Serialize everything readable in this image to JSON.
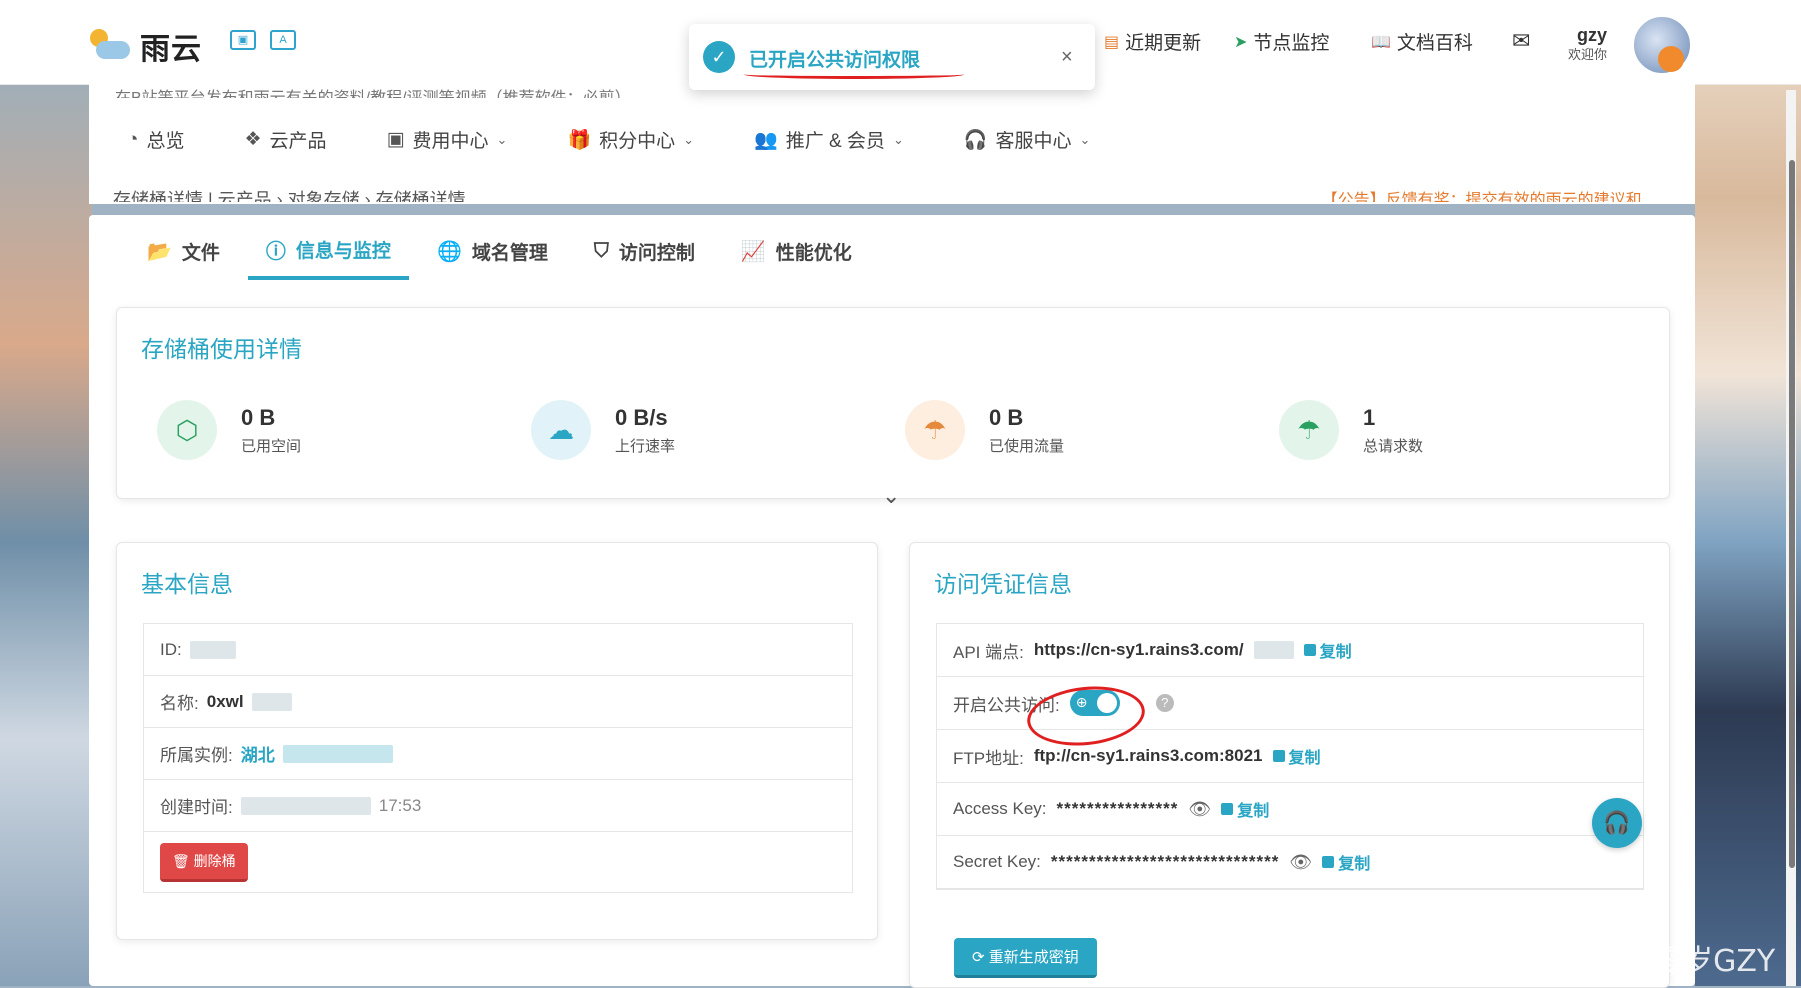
{
  "header": {
    "logo_text": "雨云",
    "links": [
      {
        "icon": "news-icon",
        "label": "近期更新"
      },
      {
        "icon": "send-icon",
        "label": "节点监控"
      },
      {
        "icon": "book-icon",
        "label": "文档百科"
      }
    ],
    "user_name": "gzy",
    "user_welcome": "欢迎你"
  },
  "toast": {
    "message": "已开启公共访问权限",
    "close": "×"
  },
  "nav": {
    "notice_top": "在B站等平台发布和雨云有关的资料/教程/评测等视频（推荐软件：必剪）",
    "items": [
      {
        "label": "总览"
      },
      {
        "label": "云产品"
      },
      {
        "label": "费用中心"
      },
      {
        "label": "积分中心"
      },
      {
        "label": "推广 & 会员"
      },
      {
        "label": "客服中心"
      }
    ],
    "breadcrumb": "存储桶详情 | 云产品 › 对象存储 › 存储桶详情",
    "notice_right": "【公告】反馈有奖：提交有效的雨云的建议和..."
  },
  "tabs": [
    {
      "label": "文件"
    },
    {
      "label": "信息与监控"
    },
    {
      "label": "域名管理"
    },
    {
      "label": "访问控制"
    },
    {
      "label": "性能优化"
    }
  ],
  "usage": {
    "title": "存储桶使用详情",
    "stats": [
      {
        "value": "0 B",
        "label": "已用空间"
      },
      {
        "value": "0 B/s",
        "label": "上行速率"
      },
      {
        "value": "0 B",
        "label": "已使用流量"
      },
      {
        "value": "1",
        "label": "总请求数"
      }
    ],
    "expand_glyph": "⌄"
  },
  "basic": {
    "title": "基本信息",
    "id_label": "ID:",
    "name_label": "名称:",
    "name_value": "0xwl",
    "instance_label": "所属实例:",
    "instance_value": "湖北",
    "created_label": "创建时间:",
    "created_value": "17:53",
    "delete_button": "删除桶"
  },
  "credentials": {
    "title": "访问凭证信息",
    "api_label": "API 端点:",
    "api_value": "https://cn-sy1.rains3.com/",
    "public_label": "开启公共访问:",
    "public_enabled": true,
    "ftp_label": "FTP地址:",
    "ftp_value": "ftp://cn-sy1.rains3.com:8021",
    "access_label": "Access Key:",
    "access_value": "****************",
    "secret_label": "Secret Key:",
    "secret_value": "******************************",
    "copy_label": "复制",
    "regen_button": "重新生成密钥"
  },
  "watermark": "CSDN @星零岁GZY",
  "colors": {
    "accent": "#2aa6c4",
    "danger": "#e04848",
    "annotation": "#e02020"
  }
}
